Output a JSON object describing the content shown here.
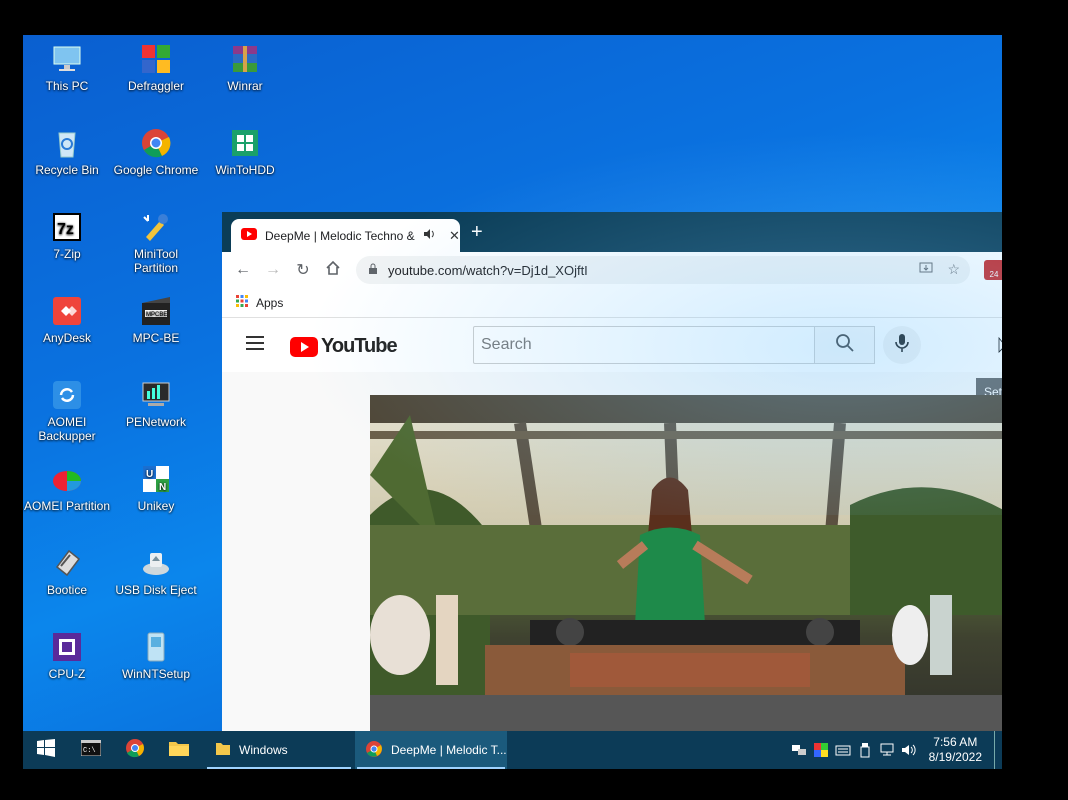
{
  "desktop": {
    "icons": [
      {
        "label": "This PC",
        "icon": "this-pc-icon"
      },
      {
        "label": "Defraggler",
        "icon": "defraggler-icon"
      },
      {
        "label": "Winrar",
        "icon": "winrar-icon"
      },
      {
        "label": "Recycle Bin",
        "icon": "recycle-bin-icon"
      },
      {
        "label": "Google Chrome",
        "icon": "chrome-icon"
      },
      {
        "label": "WinToHDD",
        "icon": "wintohdd-icon"
      },
      {
        "label": "7-Zip",
        "icon": "7zip-icon"
      },
      {
        "label": "MiniTool Partition",
        "icon": "minitool-icon"
      },
      {
        "label": "AnyDesk",
        "icon": "anydesk-icon"
      },
      {
        "label": "MPC-BE",
        "icon": "mpcbe-icon"
      },
      {
        "label": "AOMEI Backupper",
        "icon": "aomei-backupper-icon"
      },
      {
        "label": "PENetwork",
        "icon": "penetwork-icon"
      },
      {
        "label": "AOMEI Partition",
        "icon": "aomei-partition-icon"
      },
      {
        "label": "Unikey",
        "icon": "unikey-icon"
      },
      {
        "label": "Bootice",
        "icon": "bootice-icon"
      },
      {
        "label": "USB Disk Eject",
        "icon": "usb-eject-icon"
      },
      {
        "label": "CPU-Z",
        "icon": "cpuz-icon"
      },
      {
        "label": "WinNTSetup",
        "icon": "winntsetup-icon"
      }
    ]
  },
  "browser": {
    "tab_title": "DeepMe | Melodic Techno & Progressive House",
    "new_tab": "+",
    "url": "youtube.com/watch?v=Dj1d_XOjftI",
    "bookmarks_apps": "Apps",
    "extension_badge": "24"
  },
  "youtube": {
    "logo_text": "YouTube",
    "search_placeholder": "Search",
    "tooltip": "Set"
  },
  "taskbar": {
    "apps": [
      {
        "label": "Windows"
      },
      {
        "label": "DeepMe | Melodic T..."
      }
    ],
    "time": "7:56 AM",
    "date": "8/19/2022"
  },
  "colors": {
    "taskbar_bg": "#0c3b57",
    "tabstrip_bg": "#0b3d57",
    "youtube_red": "#ff0000",
    "desktop_blue": "#0a72e0"
  }
}
